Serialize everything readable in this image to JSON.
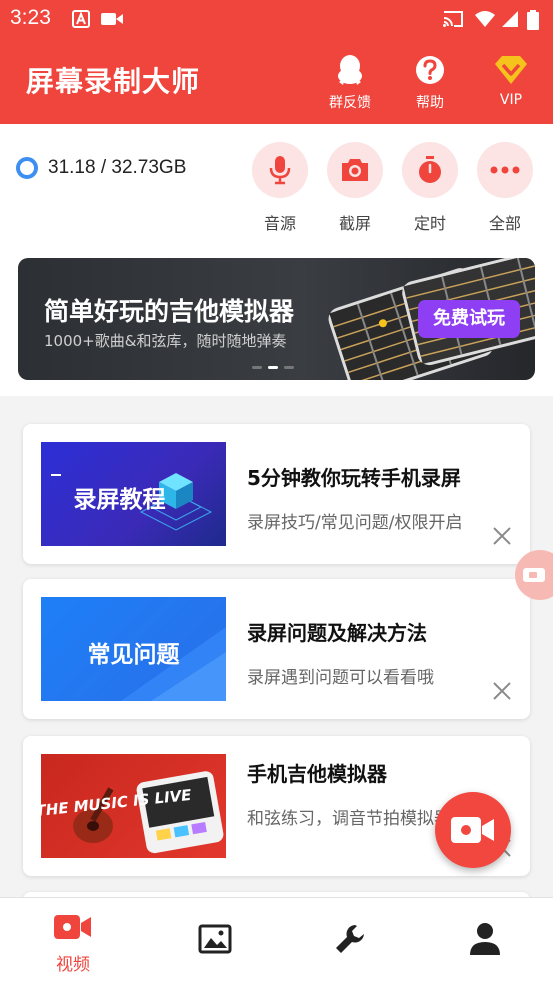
{
  "status_bar": {
    "time": "3:23"
  },
  "app_bar": {
    "title": "屏幕录制大师",
    "actions": [
      {
        "label": "群反馈",
        "icon": "qq-penguin-icon"
      },
      {
        "label": "帮助",
        "icon": "help-icon"
      },
      {
        "label": "VIP",
        "icon": "vip-diamond-icon"
      }
    ]
  },
  "storage": {
    "text": "31.18 / 32.73GB"
  },
  "tools": [
    {
      "label": "音源",
      "icon": "microphone-icon"
    },
    {
      "label": "截屏",
      "icon": "camera-icon"
    },
    {
      "label": "定时",
      "icon": "timer-icon"
    },
    {
      "label": "全部",
      "icon": "more-icon"
    }
  ],
  "banner": {
    "title": "简单好玩的吉他模拟器",
    "subtitle": "1000+歌曲&和弦库，随时随地弹奏",
    "button": "免费试玩",
    "dots_total": 3,
    "dot_active": 1
  },
  "cards": [
    {
      "thumb_text": "录屏教程",
      "title": "5分钟教你玩转手机录屏",
      "subtitle": "录屏技巧/常见问题/权限开启"
    },
    {
      "thumb_text": "常见问题",
      "title": "录屏问题及解决方法",
      "subtitle": "录屏遇到问题可以看看哦"
    },
    {
      "thumb_text": "THE MUSIC IS LIVE",
      "title": "手机吉他模拟器",
      "subtitle": "和弦练习，调音节拍模拟器"
    }
  ],
  "bottom_nav": [
    {
      "label": "视频",
      "icon": "video-icon",
      "active": true
    },
    {
      "label": "",
      "icon": "image-icon",
      "active": false
    },
    {
      "label": "",
      "icon": "wrench-icon",
      "active": false
    },
    {
      "label": "",
      "icon": "person-icon",
      "active": false
    }
  ],
  "colors": {
    "primary": "#f0453d",
    "banner_button": "#8e3ff3",
    "storage_ring": "#3d8ff2"
  }
}
